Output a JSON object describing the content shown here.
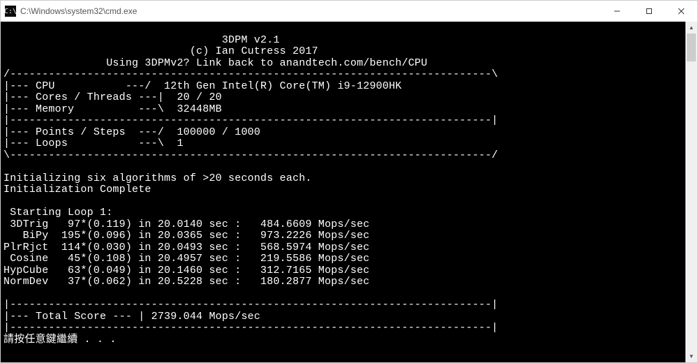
{
  "window": {
    "title": "C:\\Windows\\system32\\cmd.exe",
    "icon_glyph": "C:\\"
  },
  "header": {
    "line1": "                                  3DPM v2.1",
    "line2": "                             (c) Ian Cutress 2017",
    "line3": "                Using 3DPMv2? Link back to anandtech.com/bench/CPU"
  },
  "sysinfo": {
    "sep_top": "/---------------------------------------------------------------------------\\",
    "cpu_line": "|--- CPU           ---/  12th Gen Intel(R) Core(TM) i9-12900HK",
    "cores_line": "|--- Cores / Threads ---|  20 / 20",
    "memory_line": "|--- Memory          ---\\  32448MB",
    "sep_mid": "|---------------------------------------------------------------------------|",
    "points_line": "|--- Points / Steps  ---/  100000 / 1000",
    "loops_line": "|--- Loops           ---\\  1",
    "sep_bot": "\\---------------------------------------------------------------------------/"
  },
  "init": {
    "blank0": "",
    "line1": "Initializing six algorithms of >20 seconds each.",
    "line2": "Initialization Complete",
    "blank1": ""
  },
  "loop": {
    "header": " Starting Loop 1:",
    "r0": " 3DTrig   97*(0.119) in 20.0140 sec :   484.6609 Mops/sec",
    "r1": "   BiPy  195*(0.096) in 20.0365 sec :   973.2226 Mops/sec",
    "r2": "PlrRjct  114*(0.030) in 20.0493 sec :   568.5974 Mops/sec",
    "r3": " Cosine   45*(0.108) in 20.4957 sec :   219.5586 Mops/sec",
    "r4": "HypCube   63*(0.049) in 20.1460 sec :   312.7165 Mops/sec",
    "r5": "NormDev   37*(0.062) in 20.5228 sec :   180.2877 Mops/sec",
    "blank": ""
  },
  "total": {
    "sep_top": "|---------------------------------------------------------------------------|",
    "line": "|--- Total Score --- | 2739.044 Mops/sec",
    "sep_bot": "|---------------------------------------------------------------------------|"
  },
  "footer": {
    "prompt": "請按任意鍵繼續 . . ."
  }
}
